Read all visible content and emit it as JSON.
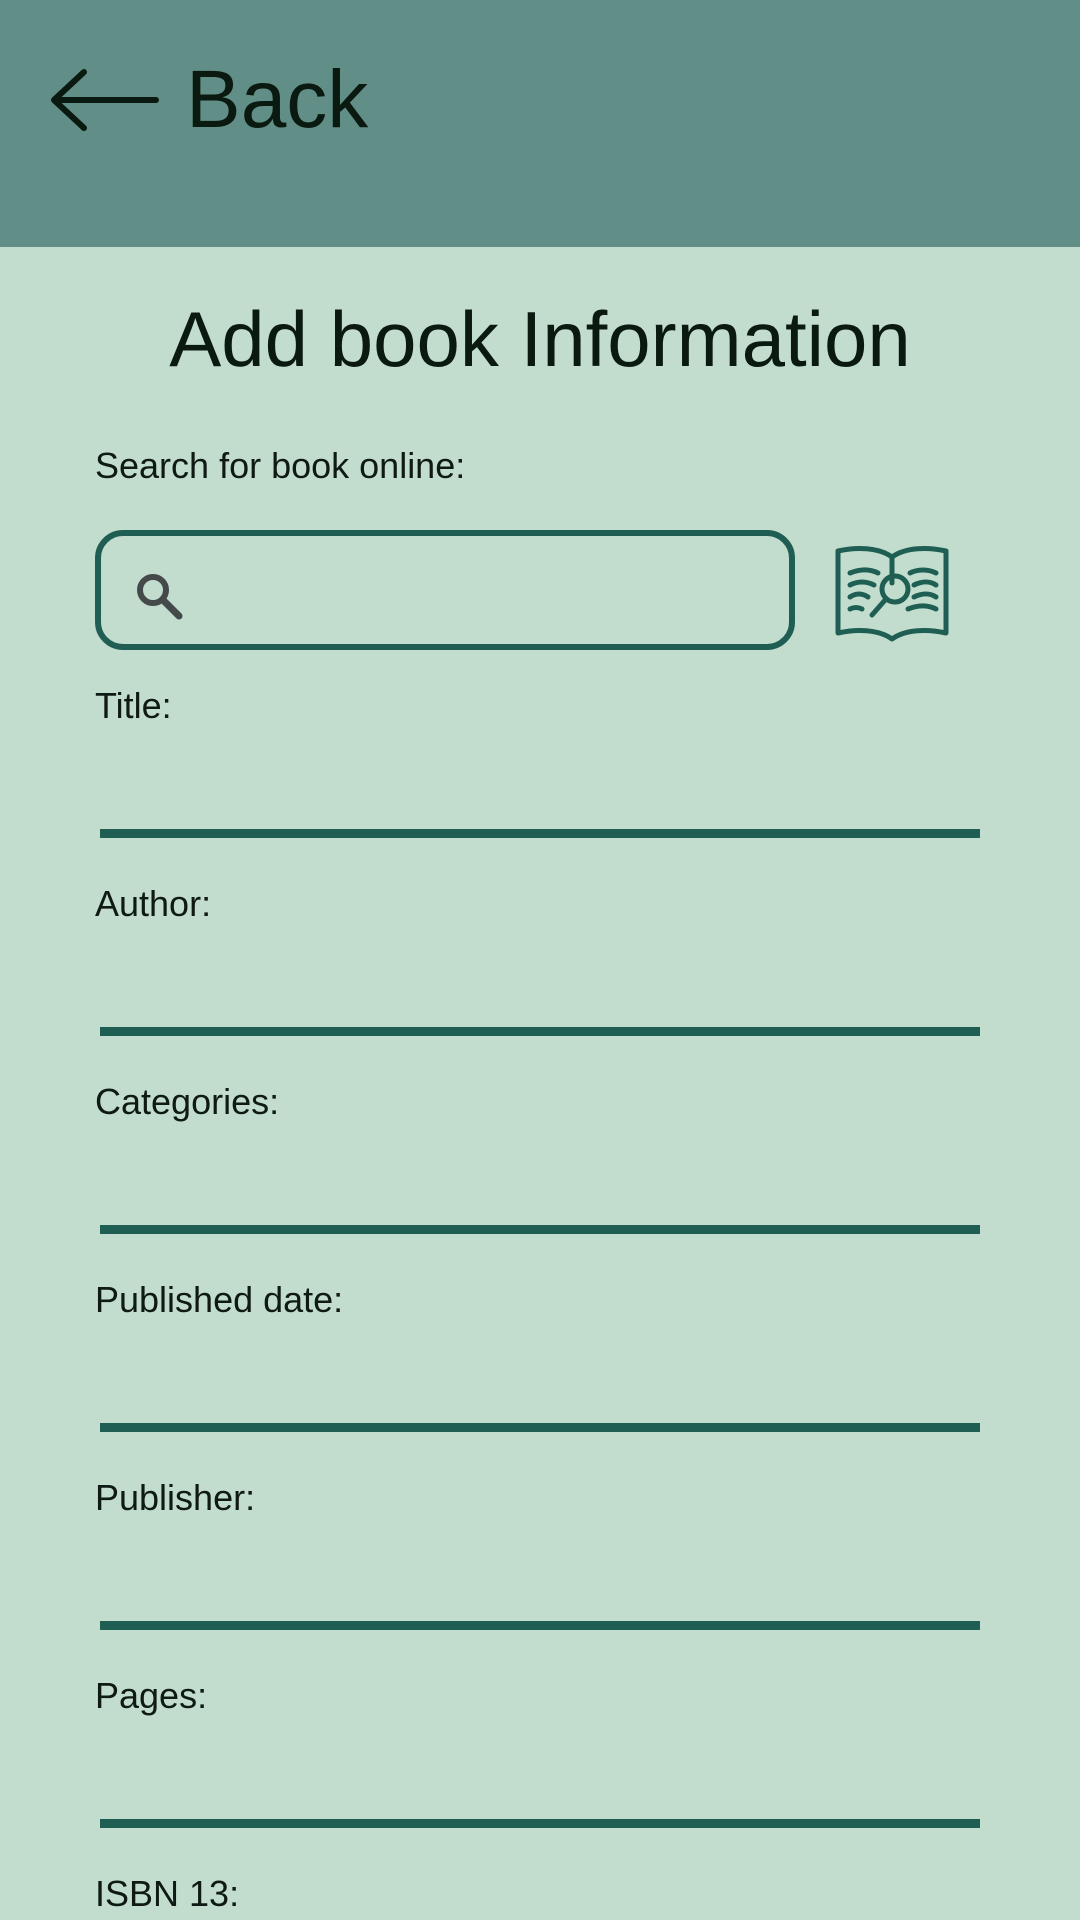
{
  "header": {
    "back_label": "Back",
    "back_icon": "arrow-left-icon",
    "bar_color": "#618f87"
  },
  "page": {
    "title": "Add book Information",
    "background": "#c2ddce",
    "accent": "#1f5e53"
  },
  "search": {
    "label": "Search for book online:",
    "value": "",
    "icon": "search-icon",
    "book_button_icon": "book-search-icon"
  },
  "fields": {
    "title": {
      "label": "Title:",
      "value": ""
    },
    "author": {
      "label": "Author:",
      "value": ""
    },
    "categories": {
      "label": "Categories:",
      "value": ""
    },
    "published_date": {
      "label": "Published date:",
      "value": ""
    },
    "publisher": {
      "label": "Publisher:",
      "value": ""
    },
    "pages": {
      "label": "Pages:",
      "value": ""
    },
    "isbn13": {
      "label": "ISBN 13:",
      "value": ""
    }
  }
}
